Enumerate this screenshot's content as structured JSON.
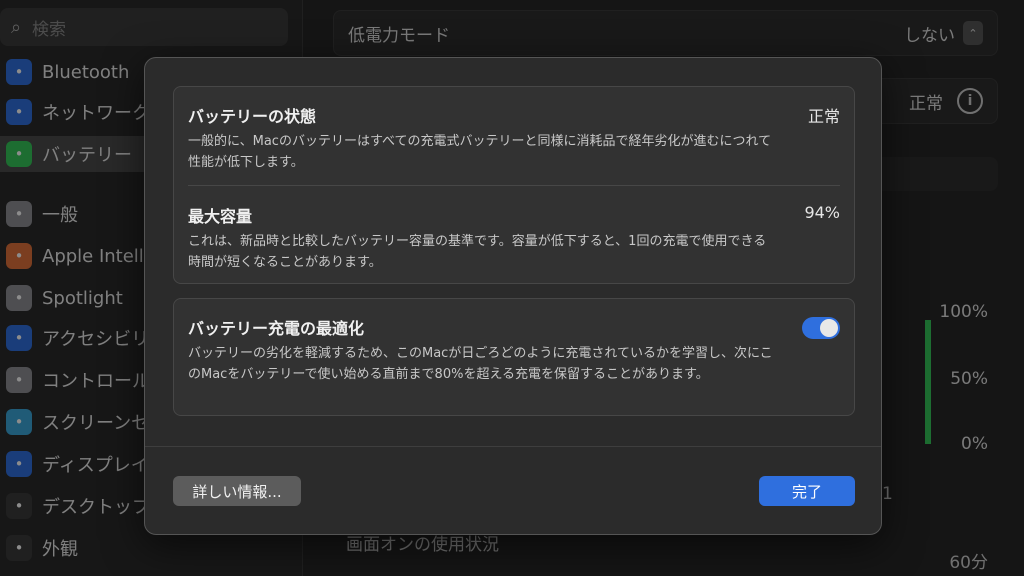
{
  "sidebar": {
    "search_placeholder": "検索",
    "items": [
      {
        "label": "Bluetooth",
        "icon": "bluetooth-icon",
        "color": "#2f6fde"
      },
      {
        "label": "ネットワーク",
        "icon": "globe-icon",
        "color": "#2f6fde"
      },
      {
        "label": "バッテリー",
        "icon": "battery-icon",
        "color": "#35c759"
      },
      {
        "label": "一般",
        "icon": "gear-icon",
        "color": "#8e8e93"
      },
      {
        "label": "Apple Intell",
        "icon": "apple-intelligence-icon",
        "color": "#e0703a"
      },
      {
        "label": "Spotlight",
        "icon": "magnifier-icon",
        "color": "#8e8e93"
      },
      {
        "label": "アクセシビリ",
        "icon": "accessibility-icon",
        "color": "#2f6fde"
      },
      {
        "label": "コントロール",
        "icon": "control-center-icon",
        "color": "#8e8e93"
      },
      {
        "label": "スクリーンセ",
        "icon": "screensaver-icon",
        "color": "#3aa6d8"
      },
      {
        "label": "ディスプレイ",
        "icon": "display-icon",
        "color": "#2f6fde"
      },
      {
        "label": "デスクトップ",
        "icon": "desktop-dock-icon",
        "color": "#3a3a3a"
      },
      {
        "label": "外観",
        "icon": "appearance-icon",
        "color": "#3a3a3a"
      }
    ]
  },
  "main": {
    "low_power_label": "低電力モード",
    "low_power_value": "しない",
    "health_value_bg": "正常",
    "chart_labels": [
      "100%",
      "50%",
      "0%"
    ],
    "chart_level": 1.0,
    "axis_tick": "1",
    "usage_title": "画面オンの使用状況",
    "usage_tick": "60分"
  },
  "sheet": {
    "battery_state": {
      "title": "バッテリーの状態",
      "value": "正常",
      "desc": "一般的に、Macのバッテリーはすべての充電式バッテリーと同様に消耗品で経年劣化が進むにつれて性能が低下します。"
    },
    "max_capacity": {
      "title": "最大容量",
      "value": "94%",
      "desc": "これは、新品時と比較したバッテリー容量の基準です。容量が低下すると、1回の充電で使用できる時間が短くなることがあります。"
    },
    "optimized_charging": {
      "title": "バッテリー充電の最適化",
      "enabled": true,
      "desc": "バッテリーの劣化を軽減するため、このMacが日ごろどのように充電されているかを学習し、次にこのMacをバッテリーで使い始める直前まで80%を超える充電を保留することがあります。"
    },
    "more_info_label": "詳しい情報...",
    "done_label": "完了"
  },
  "colors": {
    "accent": "#2f6fde",
    "battery_green": "#35c759"
  }
}
